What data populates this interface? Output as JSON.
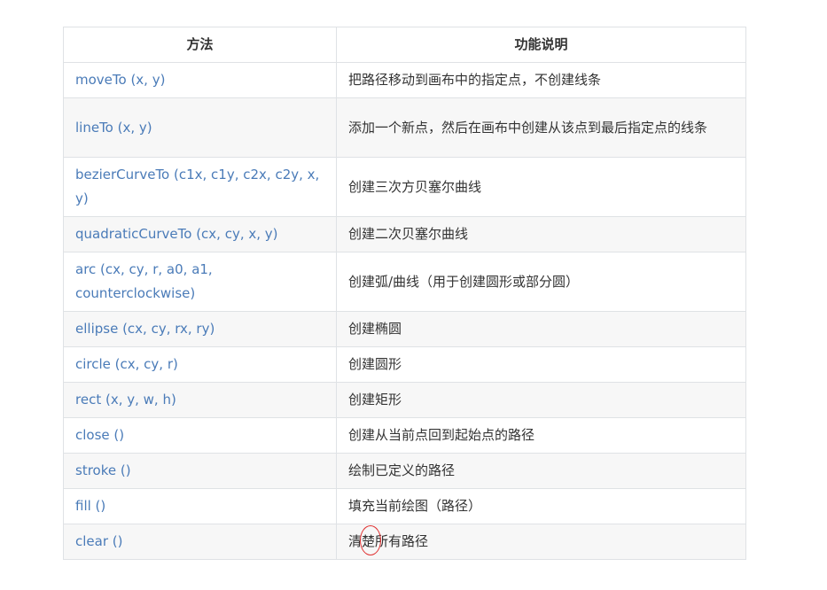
{
  "table": {
    "headers": [
      "方法",
      "功能说明"
    ],
    "rows": [
      {
        "method": "moveTo (x, y)",
        "desc": "把路径移动到画布中的指定点，不创建线条"
      },
      {
        "method": "lineTo (x, y)",
        "desc": "添加一个新点，然后在画布中创建从该点到最后指定点的线条"
      },
      {
        "method": "bezierCurveTo (c1x, c1y, c2x, c2y, x, y)",
        "desc": "创建三次方贝塞尔曲线"
      },
      {
        "method": "quadraticCurveTo (cx, cy, x, y)",
        "desc": "创建二次贝塞尔曲线"
      },
      {
        "method": "arc (cx, cy, r, a0, a1, counterclockwise)",
        "desc": "创建弧/曲线（用于创建圆形或部分圆）"
      },
      {
        "method": "ellipse (cx, cy, rx, ry)",
        "desc": "创建椭圆"
      },
      {
        "method": "circle (cx, cy, r)",
        "desc": "创建圆形"
      },
      {
        "method": "rect (x, y, w, h)",
        "desc": "创建矩形"
      },
      {
        "method": "close ()",
        "desc": "创建从当前点回到起始点的路径"
      },
      {
        "method": "stroke ()",
        "desc": "绘制已定义的路径"
      },
      {
        "method": "fill ()",
        "desc": "填充当前绘图（路径）"
      },
      {
        "method": "clear ()",
        "desc": "清楚所有路径"
      }
    ]
  },
  "colors": {
    "method_text": "#4a7bb8",
    "body_text": "#333333",
    "border": "#dfe2e5",
    "stripe": "#f7f7f7",
    "annotation": "#e03030"
  }
}
